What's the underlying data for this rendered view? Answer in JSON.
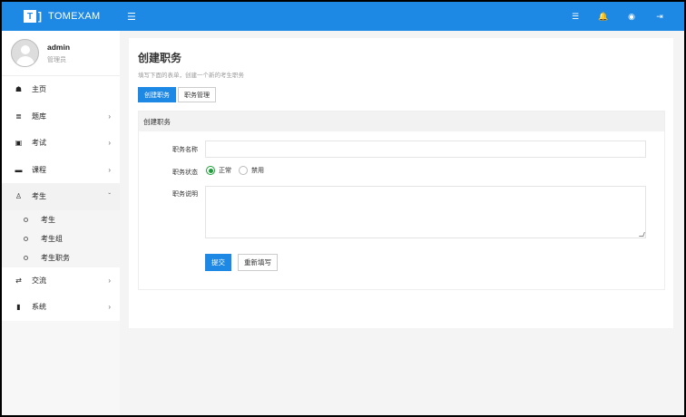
{
  "brand": {
    "logo_text": "T",
    "logo_bracket": "]",
    "name": "TOMEXAM"
  },
  "topbar": {
    "menu_icon": "☰",
    "icons": [
      {
        "name": "list-icon",
        "glyph": "☰"
      },
      {
        "name": "bell-icon",
        "glyph": "🔔"
      },
      {
        "name": "user-icon",
        "glyph": "◉"
      },
      {
        "name": "logout-icon",
        "glyph": "⇥"
      }
    ]
  },
  "user": {
    "name": "admin",
    "role": "管理员"
  },
  "nav": [
    {
      "key": "home",
      "icon": "☗",
      "label": "主页",
      "arrow": ""
    },
    {
      "key": "question-bank",
      "icon": "≣",
      "label": "题库",
      "arrow": "›"
    },
    {
      "key": "exam",
      "icon": "▣",
      "label": "考试",
      "arrow": "›"
    },
    {
      "key": "course",
      "icon": "▬",
      "label": "课程",
      "arrow": "›"
    },
    {
      "key": "examinee",
      "icon": "♙",
      "label": "考生",
      "arrow": "ˇ"
    }
  ],
  "subnav": [
    {
      "label": "考生"
    },
    {
      "label": "考生组"
    },
    {
      "label": "考生职务"
    }
  ],
  "nav_bottom": [
    {
      "key": "exchange",
      "icon": "⇄",
      "label": "交流",
      "arrow": "›"
    },
    {
      "key": "system",
      "icon": "▮",
      "label": "系统",
      "arrow": "›"
    }
  ],
  "page": {
    "title": "创建职务",
    "subtitle": "填写下面的表单，创建一个新的考生职务"
  },
  "tabs": [
    {
      "label": "创建职务"
    },
    {
      "label": "职务管理"
    }
  ],
  "panel": {
    "title": "创建职务"
  },
  "form": {
    "name_label": "职务名称",
    "status_label": "职务状态",
    "status_options": [
      "正常",
      "禁用"
    ],
    "status_selected": "正常",
    "desc_label": "职务说明",
    "submit": "提交",
    "reset": "重新填写"
  },
  "colors": {
    "primary": "#1e88e5",
    "radio_checked": "#1e9e3a"
  }
}
